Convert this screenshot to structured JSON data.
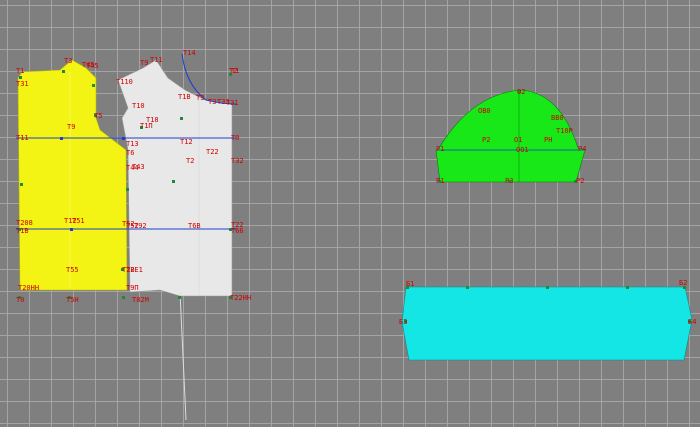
{
  "colors": {
    "background": "#7f7f7f",
    "grid": "#a8a8a8",
    "back_piece": "#f4f414",
    "front_piece": "#e8e8e8",
    "sleeve_piece": "#18e818",
    "cuff_piece": "#14e6e6",
    "point_label": "#d10000",
    "construction_line": "#1a3fd0",
    "point": "#1e8a3a"
  },
  "back_labels": [
    "Т1",
    "Т3",
    "Т45",
    "Т31",
    "Т9",
    "Т5",
    "Т6",
    "Т11",
    "Т12",
    "Т208",
    "Т1В",
    "Т55",
    "Т51",
    "Т52",
    "Т2В",
    "Т20НН",
    "Т5Н",
    "Т0"
  ],
  "front_labels": [
    "Т14",
    "Т11",
    "Т110",
    "Т10",
    "Т1П",
    "Т12",
    "Т22",
    "Т2",
    "Т1В",
    "Т18",
    "Т9",
    "Т44",
    "Т43",
    "Т13",
    "Т32",
    "Т52",
    "Т92",
    "Т6В",
    "Т22",
    "Т66",
    "Т2Е1",
    "Т9П",
    "Т82М",
    "Т22НН",
    "Т2",
    "Т3",
    "Т3",
    "Т33",
    "Т31",
    "Т45",
    "Т1",
    "Т0"
  ],
  "sleeve_labels": [
    "О2",
    "ОВ0",
    "ВВ0",
    "Т10Р",
    "О1",
    "РН",
    "Р1",
    "Р2",
    "Р4",
    "ОО1",
    "Р1",
    "Р3",
    "Р2"
  ],
  "cuff_labels": [
    "Б1",
    "Б2",
    "Б3",
    "Б4"
  ]
}
